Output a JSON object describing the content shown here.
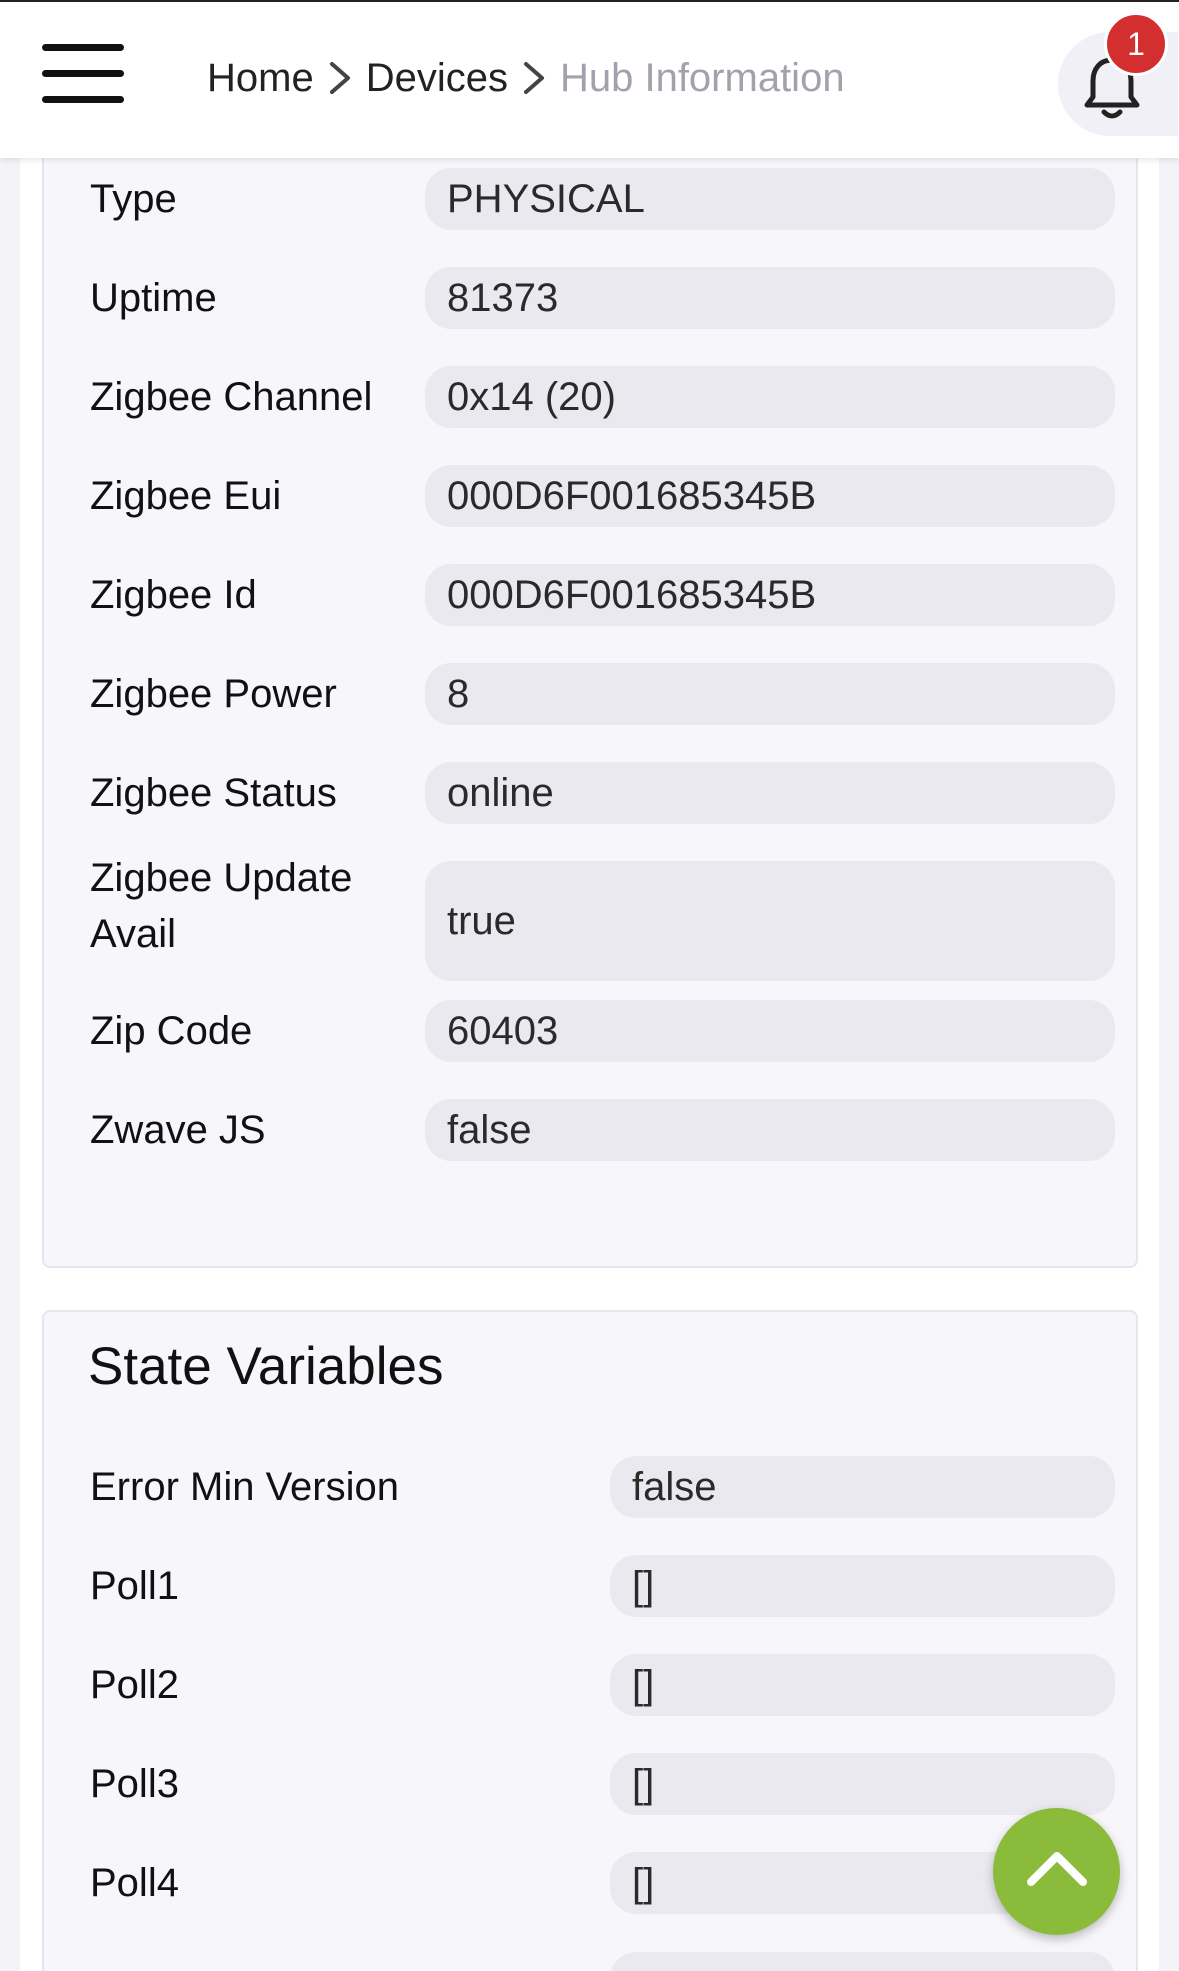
{
  "header": {
    "breadcrumb": [
      "Home",
      "Devices",
      "Hub Information"
    ],
    "notification_count": "1"
  },
  "details": {
    "partial_value": ",",
    "rows": [
      {
        "label": "Type",
        "value": "PHYSICAL"
      },
      {
        "label": "Uptime",
        "value": "81373"
      },
      {
        "label": "Zigbee Channel",
        "value": "0x14 (20)"
      },
      {
        "label": "Zigbee Eui",
        "value": "000D6F001685345B"
      },
      {
        "label": "Zigbee Id",
        "value": "000D6F001685345B"
      },
      {
        "label": "Zigbee Power",
        "value": "8"
      },
      {
        "label": "Zigbee Status",
        "value": "online"
      },
      {
        "label": "Zigbee Update Avail",
        "value": "true"
      },
      {
        "label": "Zip Code",
        "value": "60403"
      },
      {
        "label": "Zwave JS",
        "value": "false"
      }
    ]
  },
  "state_variables": {
    "title": "State Variables",
    "rows": [
      {
        "label": "Error Min Version",
        "value": "false"
      },
      {
        "label": "Poll1",
        "value": "[]"
      },
      {
        "label": "Poll2",
        "value": "[]"
      },
      {
        "label": "Poll3",
        "value": "[]"
      },
      {
        "label": "Poll4",
        "value": "[]"
      }
    ]
  },
  "icons": {
    "menu": "hamburger-menu-icon",
    "separator": "chevron-right-icon",
    "notifications": "bell-icon",
    "scroll_top": "chevron-up-icon"
  },
  "colors": {
    "badge": "#d32f2f",
    "fab": "#8bbb3a",
    "breadcrumb_current": "#a2a2ad"
  }
}
